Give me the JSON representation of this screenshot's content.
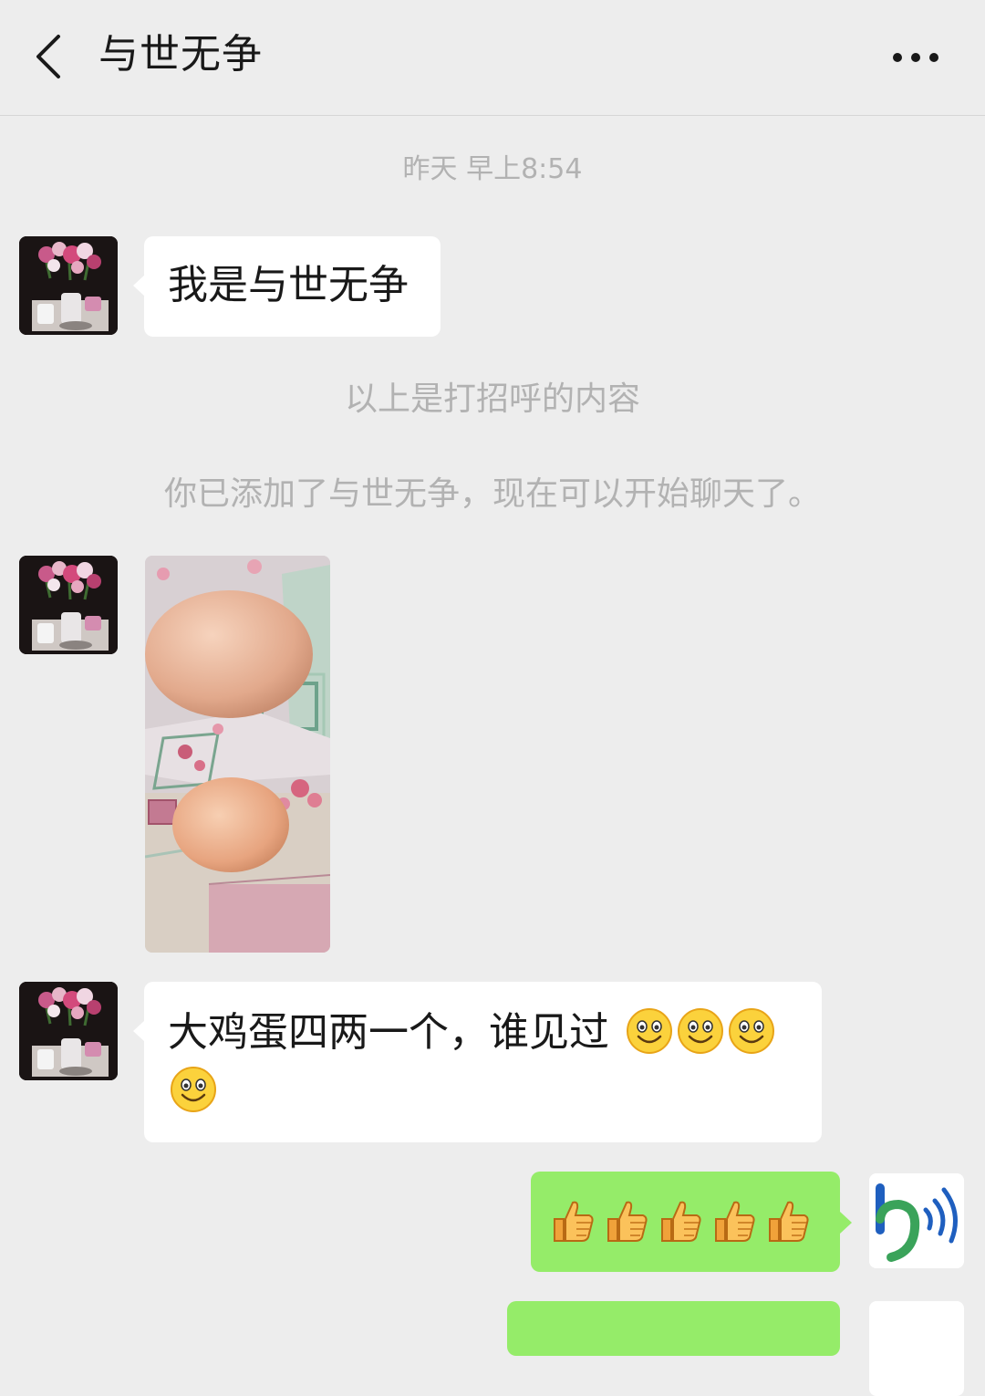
{
  "header": {
    "title": "与世无争",
    "back_icon": "chevron-left-icon",
    "more_icon": "more-horizontal-icon"
  },
  "chat": {
    "timestamp": "昨天 早上8:54",
    "messages": [
      {
        "sender": "contact",
        "type": "text",
        "text": "我是与世无争"
      },
      {
        "sender": "system",
        "type": "notice",
        "text": "以上是打招呼的内容"
      },
      {
        "sender": "system",
        "type": "notice",
        "text": "你已添加了与世无争，现在可以开始聊天了。"
      },
      {
        "sender": "contact",
        "type": "image",
        "description_icon": "photo-eggs"
      },
      {
        "sender": "contact",
        "type": "text",
        "text": "大鸡蛋四两一个，谁见过",
        "emoji": [
          "smile",
          "smile",
          "smile",
          "smile"
        ]
      },
      {
        "sender": "me",
        "type": "emoji",
        "emoji": [
          "thumbs-up",
          "thumbs-up",
          "thumbs-up",
          "thumbs-up",
          "thumbs-up"
        ]
      }
    ]
  },
  "colors": {
    "background": "#ededed",
    "incoming_bubble": "#ffffff",
    "outgoing_bubble": "#95ec69",
    "system_text": "#b2b2b2"
  }
}
